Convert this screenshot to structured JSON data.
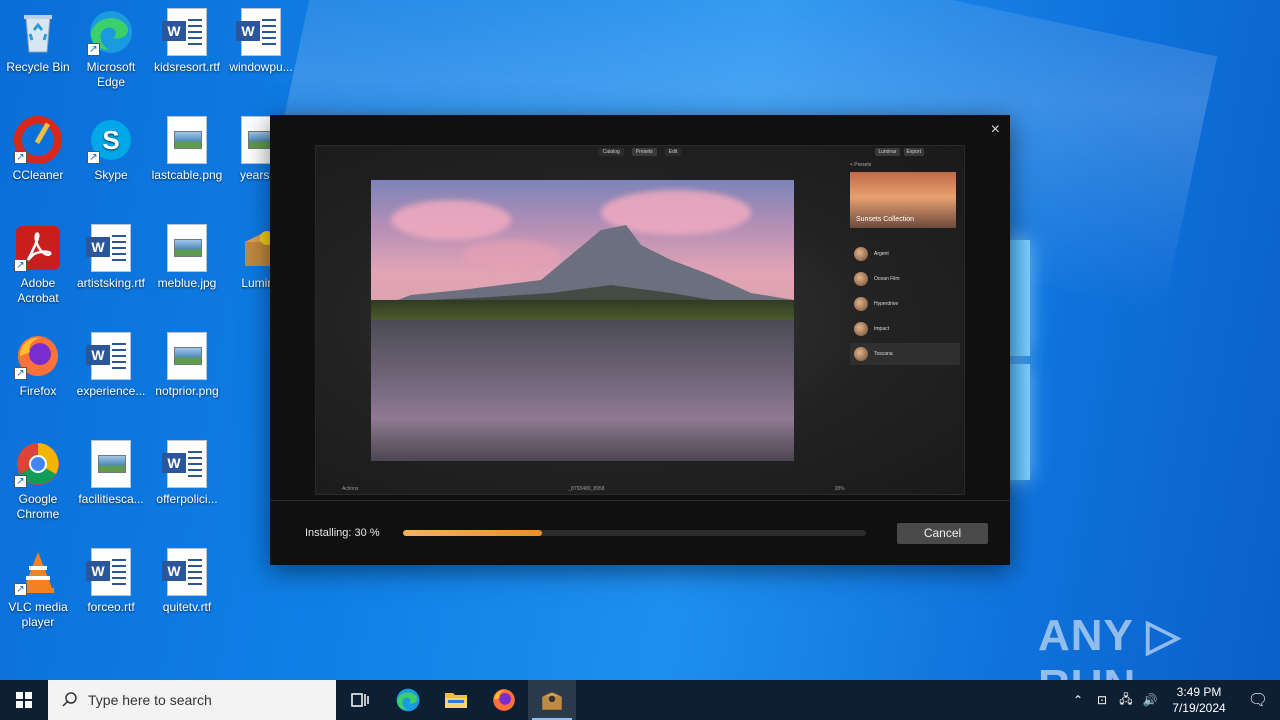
{
  "desktop": {
    "icons": [
      {
        "label": "Recycle Bin"
      },
      {
        "label": "Microsoft Edge"
      },
      {
        "label": "kidsresort.rtf"
      },
      {
        "label": "windowpu..."
      },
      {
        "label": "CCleaner"
      },
      {
        "label": "Skype"
      },
      {
        "label": "lastcable.png"
      },
      {
        "label": "yearskb"
      },
      {
        "label": "Adobe Acrobat"
      },
      {
        "label": "artistsking.rtf"
      },
      {
        "label": "meblue.jpg"
      },
      {
        "label": "Lumina"
      },
      {
        "label": "Firefox"
      },
      {
        "label": "experience..."
      },
      {
        "label": "notprior.png"
      },
      {
        "label": "Google Chrome"
      },
      {
        "label": "facilitiesca..."
      },
      {
        "label": "offerpolici..."
      },
      {
        "label": "VLC media player"
      },
      {
        "label": "forceo.rtf"
      },
      {
        "label": "quitetv.rtf"
      }
    ]
  },
  "installer": {
    "close_label": "×",
    "preview": {
      "tabs": [
        "Catalog",
        "Presets",
        "Edit"
      ],
      "top_right": [
        "Luminar",
        "Export"
      ],
      "back_label": "< Presets",
      "collection_title": "Sunsets Collection",
      "presets": [
        "Argent",
        "Ocean Film",
        "Hyperdrive",
        "Impact",
        "Toscana"
      ],
      "bottom_left": "Actions",
      "bottom_center": "_8793480_8958",
      "bottom_right": "28%"
    },
    "status_text": "Installing: 30 %",
    "progress": 0.3,
    "cancel_label": "Cancel"
  },
  "watermark": "ANY ▷ RUN",
  "taskbar": {
    "search_placeholder": "Type here to search",
    "clock_time": "3:49 PM",
    "clock_date": "7/19/2024"
  },
  "colors": {
    "desktop_bg": "#0f7fe6",
    "taskbar_bg": "#0d1f33",
    "progress_fill": "#f0901e",
    "cancel_bg": "#4a4a4a"
  }
}
